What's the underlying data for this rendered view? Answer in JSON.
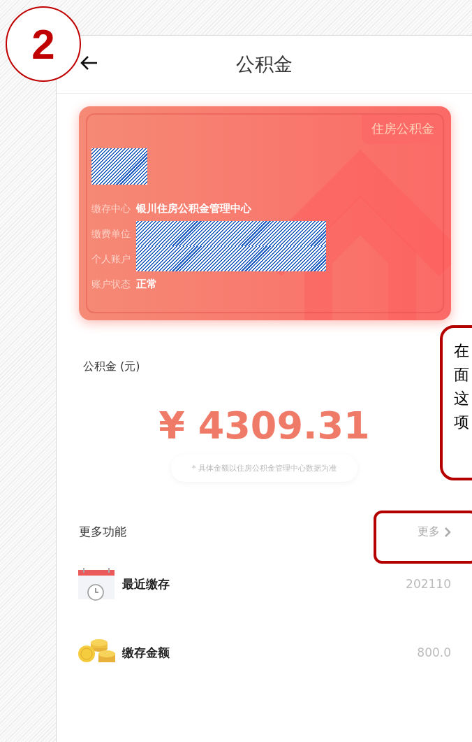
{
  "step_badge": "2",
  "header": {
    "title": "公积金"
  },
  "card": {
    "tag": "住房公积金",
    "name_redacted": true,
    "fields": [
      {
        "label": "缴存中心",
        "value": "银川住房公积金管理中心",
        "redacted": false
      },
      {
        "label": "缴费单位",
        "redacted": true
      },
      {
        "label": "个人账户",
        "redacted": true
      },
      {
        "label": "账户状态",
        "value": "正常",
        "redacted": false
      }
    ]
  },
  "balance": {
    "label": "公积金 (元)",
    "amount": "¥ 4309.31",
    "note": "* 具体金额以住房公积金管理中心数据为准"
  },
  "more": {
    "title": "更多功能",
    "link": "更多",
    "items": [
      {
        "kind": "calendar",
        "label": "最近缴存",
        "value": "202110"
      },
      {
        "kind": "coins",
        "label": "缴存金额",
        "value": "800.0"
      }
    ]
  },
  "callout": {
    "lines": [
      "在",
      "面",
      "这",
      "项"
    ]
  }
}
